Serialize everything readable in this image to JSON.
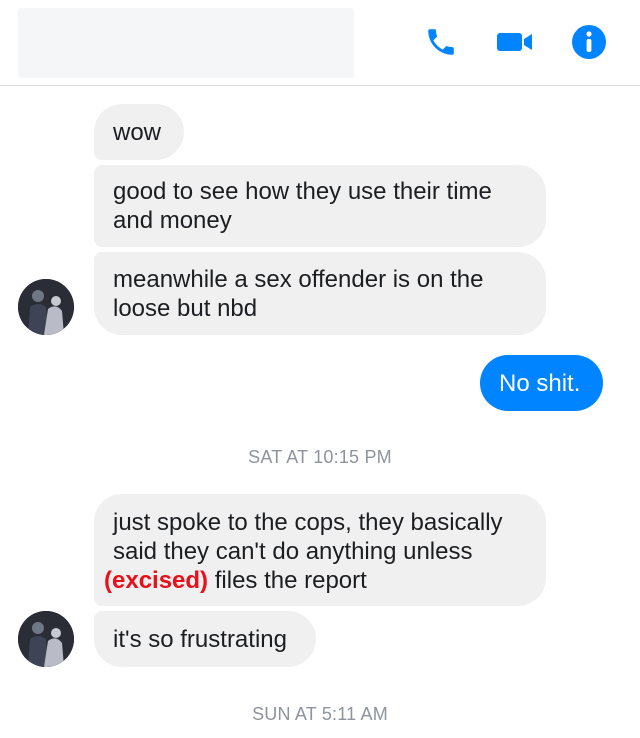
{
  "header": {
    "icons": [
      "phone-icon",
      "video-camera-icon",
      "info-icon"
    ],
    "accent": "#0084ff"
  },
  "messages": {
    "m1": "wow",
    "m2_line1": "good to see how they use their time",
    "m2_line2": "and money",
    "m3_line1": "meanwhile a sex offender is on the",
    "m3_line2": "loose but nbd",
    "m4": "No shit.",
    "ts1": "SAT AT 10:15 PM",
    "m5_line1": "just spoke to the cops, they basically",
    "m5_line2": "said they can't do anything unless",
    "m5_redaction": "(excised)",
    "m5_line3_rest": "files the report",
    "m6": "it's so frustrating",
    "ts2": "SUN AT 5:11 AM"
  },
  "colors": {
    "sent_bubble": "#0084ff",
    "received_bubble": "#f0f0f0",
    "redaction": "#e8101a",
    "timestamp": "#8d949e"
  }
}
